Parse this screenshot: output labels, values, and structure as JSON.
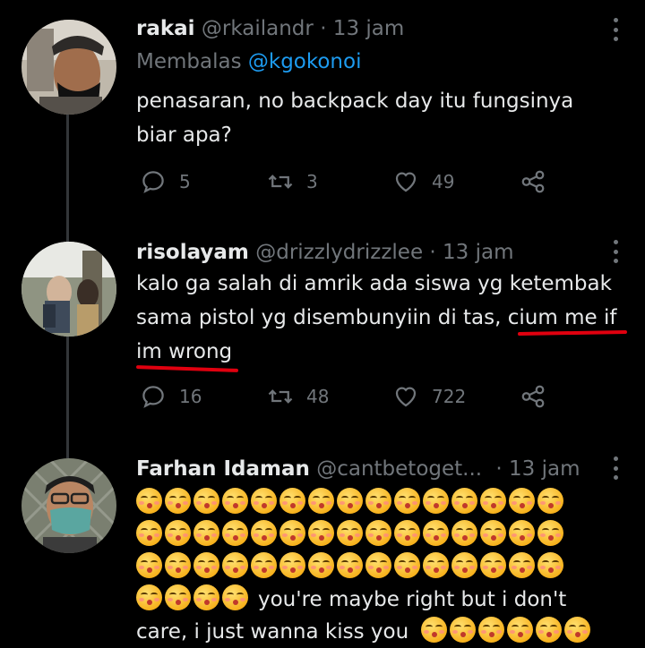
{
  "tweets": [
    {
      "name": "rakai",
      "handle": "@rkailandr",
      "time": "· 13 jam",
      "reply_prefix": "Membalas ",
      "reply_handle": "@kgokonoi",
      "text": "penasaran, no backpack day itu fungsinya biar apa?",
      "replies": "5",
      "retweets": "3",
      "likes": "49"
    },
    {
      "name": "risolayam",
      "handle": "@drizzlydrizzlee",
      "time": "· 13 jam",
      "text_before": "kalo ga salah di amrik ada siswa yg ketembak sama pistol yg disembunyiin di tas, ",
      "text_marked_1": "cium me if",
      "text_marked_2": "im wrong",
      "replies": "16",
      "retweets": "48",
      "likes": "722"
    },
    {
      "name": "Farhan Idaman",
      "handle": "@cantbetoget...",
      "time": "· 13 jam",
      "text_after_emoji_line": "you're maybe right but i don't",
      "text_last_line": "care, i just wanna kiss you"
    }
  ],
  "icons": [
    "reply-icon",
    "retweet-icon",
    "like-icon",
    "share-icon",
    "more-icon",
    "kissing-emoji-icon"
  ],
  "colors": {
    "background": "#000000",
    "text": "#e7e9ea",
    "muted": "#71767b",
    "link": "#1d9bf0",
    "annotation": "#e0000f"
  }
}
